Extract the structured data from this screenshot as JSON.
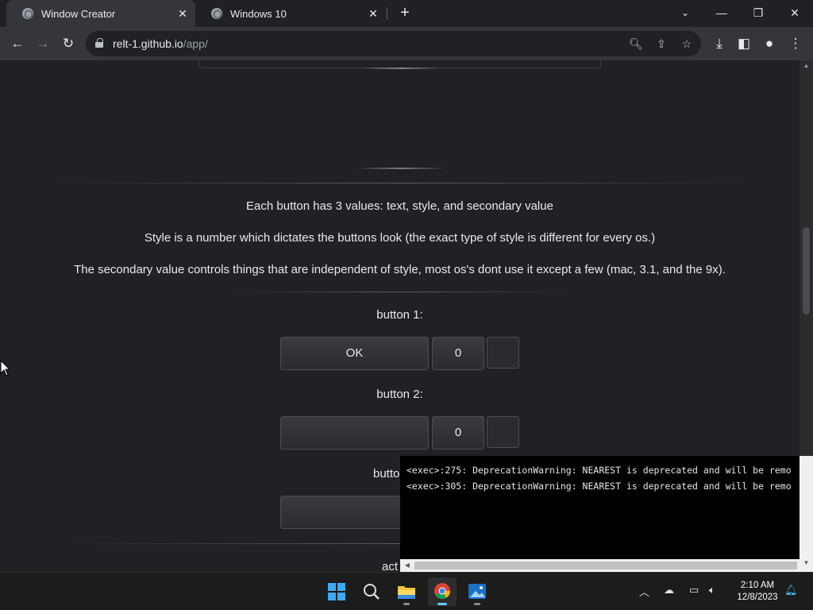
{
  "browser": {
    "tabs": [
      {
        "title": "Window Creator",
        "active": true
      },
      {
        "title": "Windows 10",
        "active": false
      }
    ],
    "url_host": "relt-1.github.io",
    "url_path": "/app/"
  },
  "page": {
    "paragraphs": [
      "Each button has 3 values: text, style, and secondary value",
      "Style is a number which dictates the buttons look (the exact type of style is different for every os.)",
      "The secondary value controls things that are independent of style, most os's dont use it except a few (mac, 3.1, and the 9x)."
    ],
    "buttons": [
      {
        "label": "button 1:",
        "text": "OK",
        "style": "0"
      },
      {
        "label": "button 2:",
        "text": "",
        "style": "0"
      },
      {
        "label": "butto",
        "text": "",
        "style": ""
      }
    ],
    "partial_label": "act"
  },
  "terminal": {
    "lines": [
      "<exec>:275: DeprecationWarning: NEAREST is deprecated and will be remo",
      "<exec>:305: DeprecationWarning: NEAREST is deprecated and will be remo"
    ]
  },
  "taskbar": {
    "apps": [
      "start",
      "search",
      "file-explorer",
      "chrome",
      "photos"
    ],
    "active_app": "chrome",
    "time": "2:10 AM",
    "date": "12/8/2023"
  },
  "colors": {
    "page_bg": "#202124",
    "toolbar_bg": "#35363a",
    "accent": "#60cdff"
  }
}
